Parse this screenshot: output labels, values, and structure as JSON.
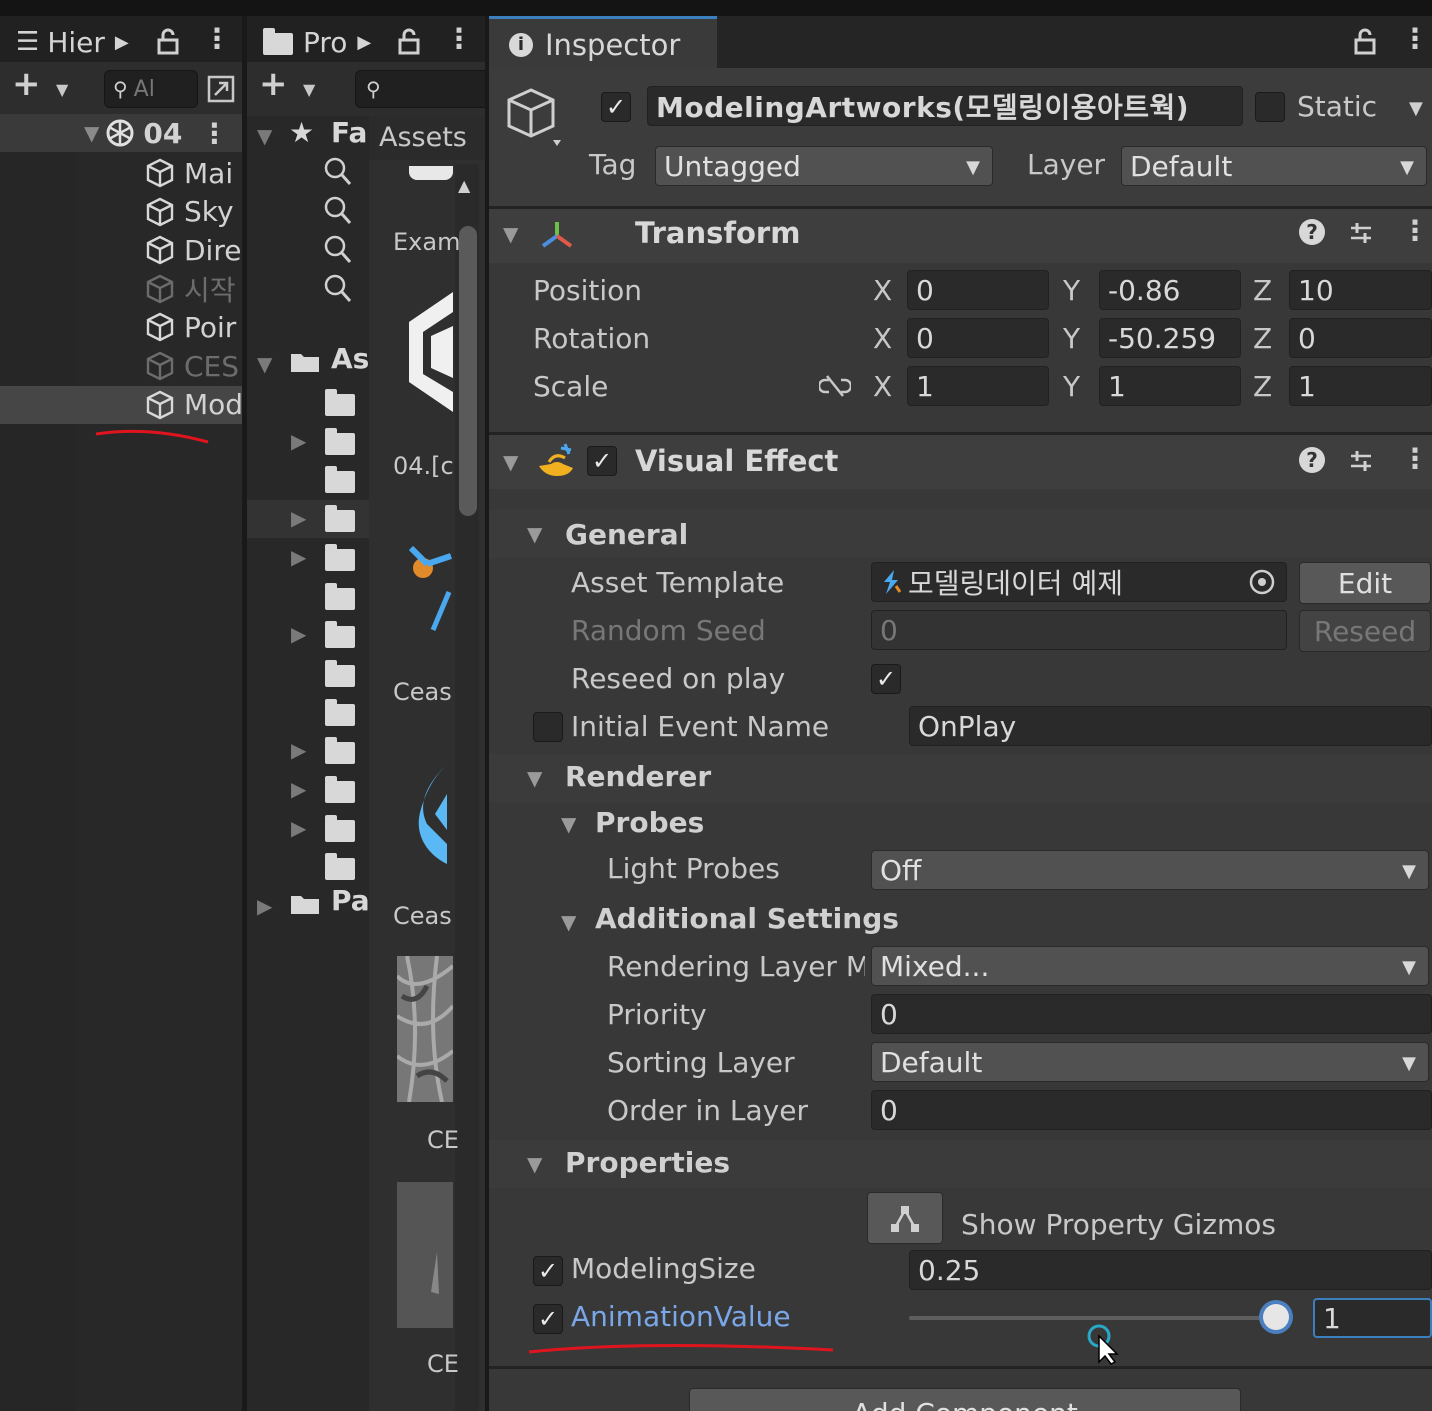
{
  "hierarchy": {
    "tab_label": "Hier",
    "search_placeholder": "Al",
    "scene": "04",
    "items": [
      {
        "label": "Mai",
        "active": true
      },
      {
        "label": "Sky",
        "active": true
      },
      {
        "label": "Dire",
        "active": true
      },
      {
        "label": "시작",
        "active": false
      },
      {
        "label": "Poir",
        "active": true
      },
      {
        "label": "CES",
        "active": false
      },
      {
        "label": "Mod",
        "active": true,
        "selected": true
      }
    ]
  },
  "project": {
    "tab_label": "Pro",
    "favorites_label": "Fa",
    "assets_root_label": "As",
    "packages_label": "Pa",
    "breadcrumb": "Assets",
    "asset_labels": [
      "Exam",
      "04.[c",
      "Ceas",
      "Ceas",
      "CE",
      "CE"
    ]
  },
  "inspector": {
    "tab_label": "Inspector",
    "object_name": "ModelingArtworks(모델링이용아트웍)",
    "static_label": "Static",
    "tag_label": "Tag",
    "tag_value": "Untagged",
    "layer_label": "Layer",
    "layer_value": "Default",
    "transform": {
      "title": "Transform",
      "position_label": "Position",
      "rotation_label": "Rotation",
      "scale_label": "Scale",
      "position": {
        "x": "0",
        "y": "-0.86",
        "z": "10"
      },
      "rotation": {
        "x": "0",
        "y": "-50.259",
        "z": "0"
      },
      "scale": {
        "x": "1",
        "y": "1",
        "z": "1"
      }
    },
    "axis": {
      "x": "X",
      "y": "Y",
      "z": "Z"
    },
    "visual_effect": {
      "title": "Visual Effect",
      "general_title": "General",
      "asset_template_label": "Asset Template",
      "asset_template_value": "모델링데이터 예제",
      "edit_label": "Edit",
      "random_seed_label": "Random Seed",
      "random_seed_value": "0",
      "reseed_label": "Reseed",
      "reseed_on_play_label": "Reseed on play",
      "initial_event_label": "Initial Event Name",
      "initial_event_value": "OnPlay",
      "renderer_title": "Renderer",
      "probes_title": "Probes",
      "light_probes_label": "Light Probes",
      "light_probes_value": "Off",
      "additional_title": "Additional Settings",
      "rendering_layer_label": "Rendering Layer M",
      "rendering_layer_value": "Mixed...",
      "priority_label": "Priority",
      "priority_value": "0",
      "sorting_layer_label": "Sorting Layer",
      "sorting_layer_value": "Default",
      "order_label": "Order in Layer",
      "order_value": "0",
      "properties_title": "Properties",
      "gizmos_label": "Show Property Gizmos",
      "modeling_size_label": "ModelingSize",
      "modeling_size_value": "0.25",
      "animation_value_label": "AnimationValue",
      "animation_value_value": "1",
      "animation_value_fraction": 1.0
    },
    "add_component_label": "Add Component"
  },
  "colors": {
    "accent_blue": "#3b7fbf",
    "annotation_red": "#e0141e",
    "link_blue": "#7aa7e8"
  }
}
